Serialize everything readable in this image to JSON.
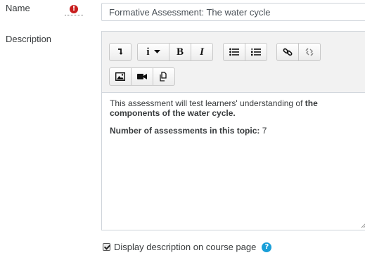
{
  "form": {
    "name_label": "Name",
    "name_value": "Formative Assessment: The water cycle",
    "description_label": "Description",
    "required_icon_glyph": "!",
    "display_on_course_label": "Display description on course page",
    "display_on_course_checked": true,
    "help_glyph": "?"
  },
  "toolbar": {
    "row1": [
      {
        "name": "collapse-toolbar",
        "icon": "arrow-down-left-icon"
      },
      {
        "name": "style",
        "label": "i",
        "icon": "caret-down-icon"
      },
      {
        "name": "bold",
        "label": "B"
      },
      {
        "name": "italic",
        "label": "I"
      },
      {
        "name": "unordered-list",
        "icon": "bullet-list-icon"
      },
      {
        "name": "ordered-list",
        "icon": "numbered-list-icon"
      },
      {
        "name": "link",
        "icon": "link-icon"
      },
      {
        "name": "unlink",
        "icon": "unlink-icon"
      }
    ],
    "row2": [
      {
        "name": "insert-image",
        "icon": "image-icon"
      },
      {
        "name": "insert-media",
        "icon": "video-camera-icon"
      },
      {
        "name": "manage-files",
        "icon": "copy-files-icon"
      }
    ]
  },
  "editor": {
    "p1_text": "This assessment will test learners' understanding of ",
    "p1_bold": "the components of the water cycle.",
    "p2_bold": "Number of assessments in this topic:",
    "p2_value": " 7"
  },
  "colors": {
    "required": "#c81e1e",
    "help": "#1a9fd8",
    "toolbar_bg": "#f2f2f2",
    "border": "#cfd4da"
  }
}
